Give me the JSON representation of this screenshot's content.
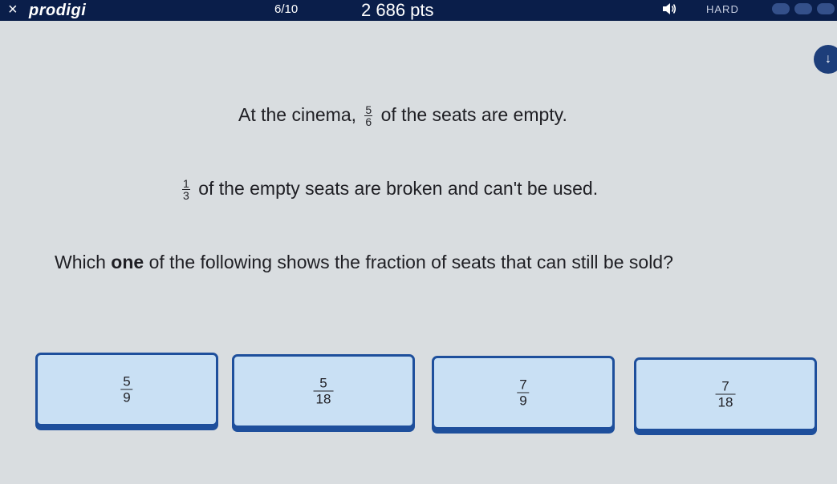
{
  "header": {
    "close_label": "×",
    "logo": "prodigi",
    "progress": "6/10",
    "points": "2 686 pts",
    "difficulty": "HARD",
    "speaker_icon": "speaker-icon",
    "difficulty_dots": 3
  },
  "hint": {
    "icon": "hint-icon",
    "glyph": "↓"
  },
  "question": {
    "line1_before": "At the cinema,",
    "line1_frac": {
      "num": "5",
      "den": "6"
    },
    "line1_after": "of the seats are empty.",
    "line2_frac": {
      "num": "1",
      "den": "3"
    },
    "line2_after": "of the empty seats are broken and can't be used.",
    "line3_before": "Which",
    "line3_bold": "one",
    "line3_after": "of the following shows the fraction of seats that can still be sold?"
  },
  "answers": [
    {
      "num": "5",
      "den": "9"
    },
    {
      "num": "5",
      "den": "18"
    },
    {
      "num": "7",
      "den": "9"
    },
    {
      "num": "7",
      "den": "18"
    }
  ],
  "colors": {
    "header_bg": "#0a1e4a",
    "page_bg": "#d9dde0",
    "answer_bg": "#c9e0f4",
    "answer_border": "#1e4f9c"
  }
}
